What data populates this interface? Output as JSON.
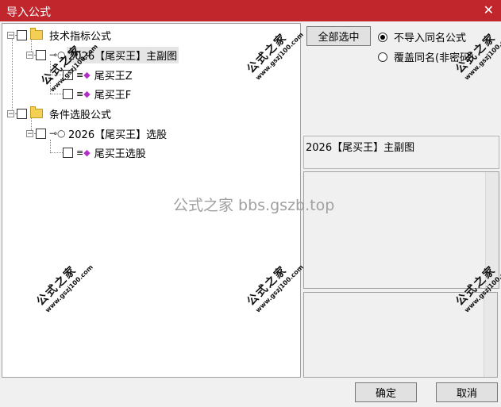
{
  "window": {
    "title": "导入公式",
    "close_glyph": "✕"
  },
  "tree": {
    "nodes": [
      {
        "label": "技术指标公式",
        "type": "folder"
      },
      {
        "label": "2026【尾买王】主副图",
        "type": "group",
        "selected": true
      },
      {
        "label": "尾买王Z",
        "type": "formula"
      },
      {
        "label": "尾买王F",
        "type": "formula"
      },
      {
        "label": "条件选股公式",
        "type": "folder"
      },
      {
        "label": "2026【尾买王】选股",
        "type": "group"
      },
      {
        "label": "尾买王选股",
        "type": "formula"
      }
    ]
  },
  "options": {
    "select_all_label": "全部选中",
    "radio_skip_label": "不导入同名公式",
    "radio_overwrite_label": "覆盖同名(非密码)",
    "selected_option": "skip"
  },
  "selected_formula_name": "2026【尾买王】主副图",
  "footer": {
    "ok_label": "确定",
    "cancel_label": "取消"
  },
  "watermark": {
    "stamp_text": "公式之家",
    "stamp_url": "www.gszj100.com",
    "center_text": "公式之家 bbs.gszb.top"
  },
  "colors": {
    "titlebar": "#c0262c",
    "formula_icon": "#b330c8",
    "folder_icon": "#f3cf55"
  }
}
